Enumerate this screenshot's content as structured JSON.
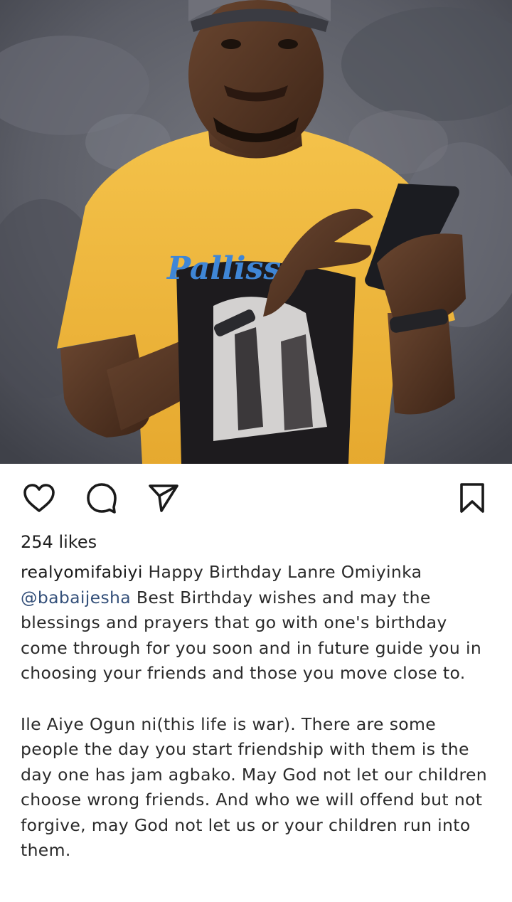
{
  "post": {
    "likes_text": "254 likes",
    "username": "realyomifabiyi",
    "caption_part1_a": " Happy Birthday Lanre Omiyinka ",
    "mention": "@babaijesha",
    "caption_part1_b": " Best Birthday wishes and may the blessings and prayers that go with one's birthday come through for you soon and in future guide you in choosing your friends and those you move close to.",
    "caption_part2": "Ile Aiye Ogun ni(this life is war). There are some people the day you start friendship with them is the day one has jam agbako. May God not let our children choose wrong friends. And who we will offend but not forgive, may God not let us or your children run into them.",
    "shirt_print_text": "Palliss"
  },
  "icons": {
    "like": "heart-outline-icon",
    "comment": "speech-bubble-icon",
    "share": "paper-plane-icon",
    "save": "bookmark-outline-icon"
  },
  "colors": {
    "text": "#262626",
    "mention": "#34507a",
    "shirt": "#f0b93a",
    "backdrop": "#5a5c66"
  }
}
